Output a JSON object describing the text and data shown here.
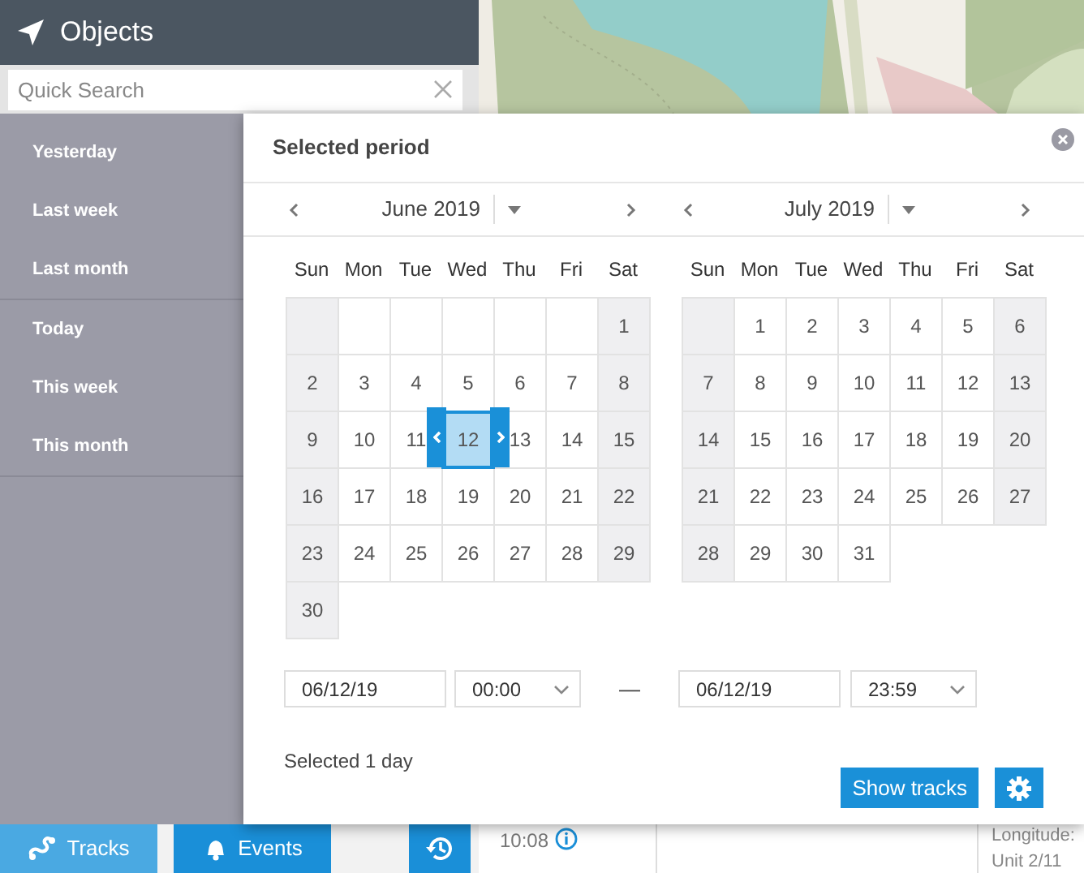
{
  "objects_panel": {
    "title": "Objects",
    "search": {
      "placeholder": "Quick Search"
    }
  },
  "period_menu": {
    "groups": [
      {
        "items": [
          {
            "label": "Yesterday"
          },
          {
            "label": "Last week"
          },
          {
            "label": "Last month"
          }
        ]
      },
      {
        "items": [
          {
            "label": "Today"
          },
          {
            "label": "This week"
          },
          {
            "label": "This month"
          }
        ]
      }
    ]
  },
  "dialog": {
    "title": "Selected period",
    "months": [
      {
        "title": "June 2019",
        "weekdays": [
          "Sun",
          "Mon",
          "Tue",
          "Wed",
          "Thu",
          "Fri",
          "Sat"
        ],
        "weeks": [
          [
            {
              "kind": "blank"
            },
            {
              "kind": "blank"
            },
            {
              "kind": "blank"
            },
            {
              "kind": "blank"
            },
            {
              "kind": "blank"
            },
            {
              "kind": "blank"
            },
            {
              "day": "1",
              "selected": false
            }
          ],
          [
            {
              "day": "2",
              "selected": false
            },
            {
              "day": "3",
              "selected": false
            },
            {
              "day": "4",
              "selected": false
            },
            {
              "day": "5",
              "selected": false
            },
            {
              "day": "6",
              "selected": false
            },
            {
              "day": "7",
              "selected": false
            },
            {
              "day": "8",
              "selected": false
            }
          ],
          [
            {
              "day": "9",
              "selected": false
            },
            {
              "day": "10",
              "selected": false
            },
            {
              "day": "11",
              "selected": false
            },
            {
              "day": "12",
              "selected": true
            },
            {
              "day": "13",
              "selected": false
            },
            {
              "day": "14",
              "selected": false
            },
            {
              "day": "15",
              "selected": false
            }
          ],
          [
            {
              "day": "16",
              "selected": false
            },
            {
              "day": "17",
              "selected": false
            },
            {
              "day": "18",
              "selected": false
            },
            {
              "day": "19",
              "selected": false
            },
            {
              "day": "20",
              "selected": false
            },
            {
              "day": "21",
              "selected": false
            },
            {
              "day": "22",
              "selected": false
            }
          ],
          [
            {
              "day": "23",
              "selected": false
            },
            {
              "day": "24",
              "selected": false
            },
            {
              "day": "25",
              "selected": false
            },
            {
              "day": "26",
              "selected": false
            },
            {
              "day": "27",
              "selected": false
            },
            {
              "day": "28",
              "selected": false
            },
            {
              "day": "29",
              "selected": false
            }
          ],
          [
            {
              "day": "30",
              "selected": false
            }
          ]
        ]
      },
      {
        "title": "July 2019",
        "weekdays": [
          "Sun",
          "Mon",
          "Tue",
          "Wed",
          "Thu",
          "Fri",
          "Sat"
        ],
        "weeks": [
          [
            {
              "kind": "blank"
            },
            {
              "day": "1",
              "selected": false
            },
            {
              "day": "2",
              "selected": false
            },
            {
              "day": "3",
              "selected": false
            },
            {
              "day": "4",
              "selected": false
            },
            {
              "day": "5",
              "selected": false
            },
            {
              "day": "6",
              "selected": false
            }
          ],
          [
            {
              "day": "7",
              "selected": false
            },
            {
              "day": "8",
              "selected": false
            },
            {
              "day": "9",
              "selected": false
            },
            {
              "day": "10",
              "selected": false
            },
            {
              "day": "11",
              "selected": false
            },
            {
              "day": "12",
              "selected": false
            },
            {
              "day": "13",
              "selected": false
            }
          ],
          [
            {
              "day": "14",
              "selected": false
            },
            {
              "day": "15",
              "selected": false
            },
            {
              "day": "16",
              "selected": false
            },
            {
              "day": "17",
              "selected": false
            },
            {
              "day": "18",
              "selected": false
            },
            {
              "day": "19",
              "selected": false
            },
            {
              "day": "20",
              "selected": false
            }
          ],
          [
            {
              "day": "21",
              "selected": false
            },
            {
              "day": "22",
              "selected": false
            },
            {
              "day": "23",
              "selected": false
            },
            {
              "day": "24",
              "selected": false
            },
            {
              "day": "25",
              "selected": false
            },
            {
              "day": "26",
              "selected": false
            },
            {
              "day": "27",
              "selected": false
            }
          ],
          [
            {
              "day": "28",
              "selected": false
            },
            {
              "day": "29",
              "selected": false
            },
            {
              "day": "30",
              "selected": false
            },
            {
              "day": "31",
              "selected": false
            }
          ]
        ]
      }
    ],
    "range": {
      "start_date": "06/12/19",
      "start_time": "00:00",
      "separator": "—",
      "end_date": "06/12/19",
      "end_time": "23:59"
    },
    "summary": "Selected 1 day",
    "buttons": [
      {
        "kind": "text",
        "label": "Show tracks"
      },
      {
        "kind": "settings"
      }
    ]
  },
  "bottom_bar": {
    "tabs": [
      {
        "label": "Tracks",
        "selected": true,
        "kind": "tracks"
      },
      {
        "label": "Events",
        "selected": false,
        "kind": "events"
      }
    ]
  },
  "list_behind": {
    "time": "10:08",
    "details": [
      "Longitude:",
      "Unit 2/11"
    ]
  }
}
